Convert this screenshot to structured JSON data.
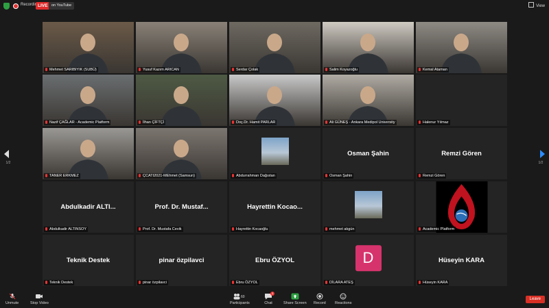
{
  "topbar": {
    "recording_label": "Recording",
    "live_label": "LIVE",
    "stream_dropdown": "on YouTube",
    "view_label": "View"
  },
  "pager": {
    "left": "1/2",
    "right": "1/2"
  },
  "tiles": [
    {
      "name": "Mehmet SARIBIYIK (SUBÜ)",
      "type": "video"
    },
    {
      "name": "Yusuf Kazım ARICAN",
      "type": "video"
    },
    {
      "name": "Serdar Çolak",
      "type": "video"
    },
    {
      "name": "Salim Koyazoğlu",
      "type": "video"
    },
    {
      "name": "Kemal Ataman",
      "type": "video"
    },
    {
      "name": "Nazif ÇAĞLAR - Academic Platform",
      "type": "video"
    },
    {
      "name": "İlhan ÇİFTÇİ",
      "type": "video"
    },
    {
      "name": "Doç.Dr. Hamit PARLAR",
      "type": "video"
    },
    {
      "name": "Ali GÜNEŞ - Ankara Medipol University",
      "type": "video"
    },
    {
      "name": "Halenur Yılmaz",
      "type": "empty",
      "display": ""
    },
    {
      "name": "TANER ERKMEZ",
      "type": "video"
    },
    {
      "name": "ÇCATI2021-MEhmet (Samsun)",
      "type": "video"
    },
    {
      "name": "Abdurrahman Dağıstan",
      "type": "thumb"
    },
    {
      "name": "Osman Şahin",
      "type": "text",
      "display": "Osman Şahin"
    },
    {
      "name": "Remzi Gören",
      "type": "text",
      "display": "Remzi Gören"
    },
    {
      "name": "Abdulkadir ALTINSOY",
      "type": "text",
      "display": "Abdulkadir  ALTI..."
    },
    {
      "name": "Prof. Dr. Mustafa Cevik",
      "type": "text",
      "display": "Prof. Dr. Mustaf..."
    },
    {
      "name": "Hayrettin Kocaoğlu",
      "type": "text",
      "display": "Hayrettin  Kocao..."
    },
    {
      "name": "mehmet akgün",
      "type": "thumb"
    },
    {
      "name": "Academic Platform",
      "type": "logo"
    },
    {
      "name": "Teknik Destek",
      "type": "text",
      "display": "Teknik Destek"
    },
    {
      "name": "pinar özpilavci",
      "type": "text",
      "display": "pinar özpilavci"
    },
    {
      "name": "Ebru ÖZYOL",
      "type": "text",
      "display": "Ebru ÖZYOL"
    },
    {
      "name": "DİLARA ATEŞ",
      "type": "avatar",
      "display": "D"
    },
    {
      "name": "Hüseyin KARA",
      "type": "text",
      "display": "Hüseyin KARA"
    }
  ],
  "toolbar": {
    "unmute": "Unmute",
    "stop_video": "Stop Video",
    "participants": "Participants",
    "participants_count": "60",
    "chat": "Chat",
    "chat_count": "3",
    "share": "Share Screen",
    "record": "Record",
    "reactions": "Reactions",
    "leave": "Leave"
  },
  "colors": {
    "active_speaker": "#c8e34a",
    "live": "#e02b2b",
    "share": "#2ea043",
    "leave": "#d93025",
    "avatar": "#d6336c"
  }
}
